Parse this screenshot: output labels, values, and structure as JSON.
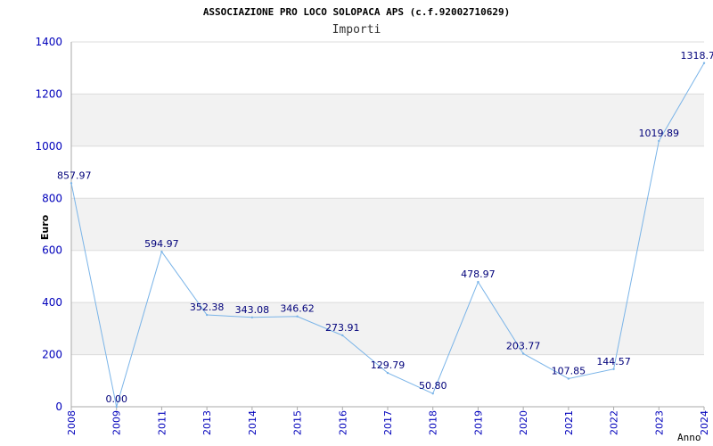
{
  "chart_data": {
    "type": "line",
    "title": "ASSOCIAZIONE PRO LOCO SOLOPACA APS (c.f.92002710629)",
    "subtitle": "Importi",
    "xlabel": "Anno",
    "ylabel": "Euro",
    "ylim": [
      0,
      1400
    ],
    "yticks": [
      0,
      200,
      400,
      600,
      800,
      1000,
      1200,
      1400
    ],
    "grid": true,
    "categories": [
      "2008",
      "2009",
      "2011",
      "2013",
      "2014",
      "2015",
      "2016",
      "2017",
      "2018",
      "2019",
      "2020",
      "2021",
      "2022",
      "2023",
      "2024"
    ],
    "series": [
      {
        "values": [
          857.97,
          0.0,
          594.97,
          352.38,
          343.08,
          346.62,
          273.91,
          129.79,
          50.8,
          478.97,
          203.77,
          107.85,
          144.57,
          1019.89,
          1318.7
        ],
        "labels": [
          "857.97",
          "0.00",
          "594.97",
          "352.38",
          "343.08",
          "346.62",
          "273.91",
          "129.79",
          "50.80",
          "478.97",
          "203.77",
          "107.85",
          "144.57",
          "1019.89",
          "1318.7"
        ]
      }
    ],
    "colors": {
      "line": "#7ab4e8",
      "axis_text": "#0000bb",
      "data_label": "#00007a",
      "band": "#f2f2f2",
      "gridline": "#dcdcdc",
      "axis": "#aaaaaa"
    }
  }
}
